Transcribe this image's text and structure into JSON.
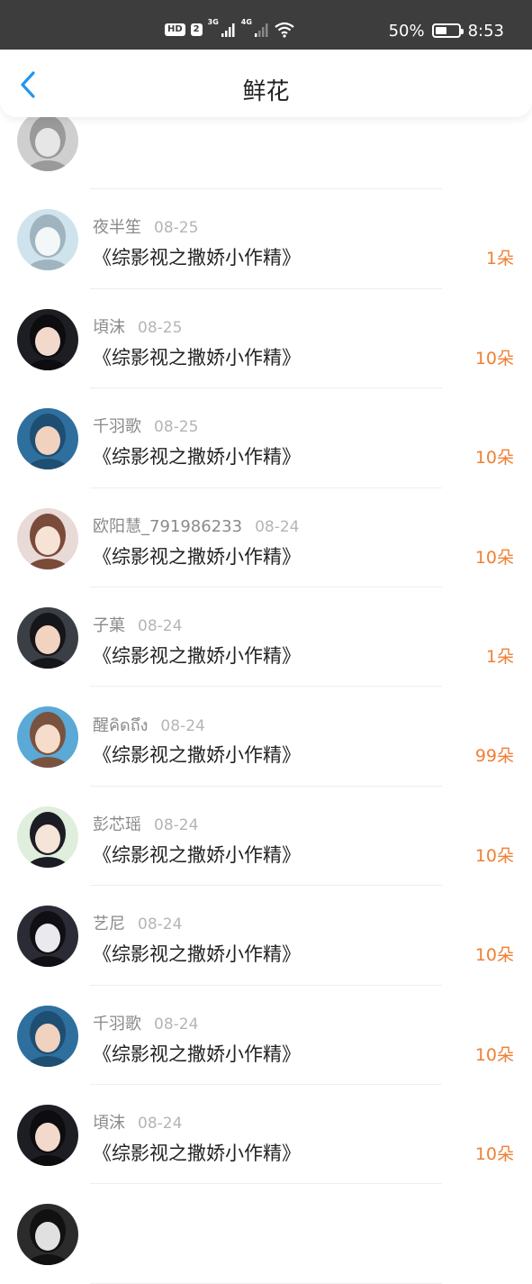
{
  "status_bar": {
    "hd": "HD",
    "sim": "2",
    "net1": "3G",
    "net2": "4G",
    "battery_percent": "50%",
    "battery_level": 0.5,
    "time": "8:53"
  },
  "header": {
    "title": "鲜花",
    "back_icon": "chevron-left-icon"
  },
  "colors": {
    "accent": "#2196F3",
    "count": "#EF8035",
    "status_bar_bg": "#3D3D3D"
  },
  "rows": [
    {
      "name": "",
      "date": "",
      "book": "",
      "count": ""
    },
    {
      "name": "夜半笙",
      "date": "08-25",
      "book": "《综影视之撒娇小作精》",
      "count": "1朵"
    },
    {
      "name": "頃沫",
      "date": "08-25",
      "book": "《综影视之撒娇小作精》",
      "count": "10朵"
    },
    {
      "name": "千羽歌",
      "date": "08-25",
      "book": "《综影视之撒娇小作精》",
      "count": "10朵"
    },
    {
      "name": "欧阳慧_791986233",
      "date": "08-24",
      "book": "《综影视之撒娇小作精》",
      "count": "10朵"
    },
    {
      "name": "子菓",
      "date": "08-24",
      "book": "《综影视之撒娇小作精》",
      "count": "1朵"
    },
    {
      "name": "醒คิดถึง",
      "date": "08-24",
      "book": "《综影视之撒娇小作精》",
      "count": "99朵"
    },
    {
      "name": "彭芯瑶",
      "date": "08-24",
      "book": "《综影视之撒娇小作精》",
      "count": "10朵"
    },
    {
      "name": "艺尼",
      "date": "08-24",
      "book": "《综影视之撒娇小作精》",
      "count": "10朵"
    },
    {
      "name": "千羽歌",
      "date": "08-24",
      "book": "《综影视之撒娇小作精》",
      "count": "10朵"
    },
    {
      "name": "頃沫",
      "date": "08-24",
      "book": "《综影视之撒娇小作精》",
      "count": "10朵"
    },
    {
      "name": "",
      "date": "",
      "book": "",
      "count": ""
    }
  ]
}
